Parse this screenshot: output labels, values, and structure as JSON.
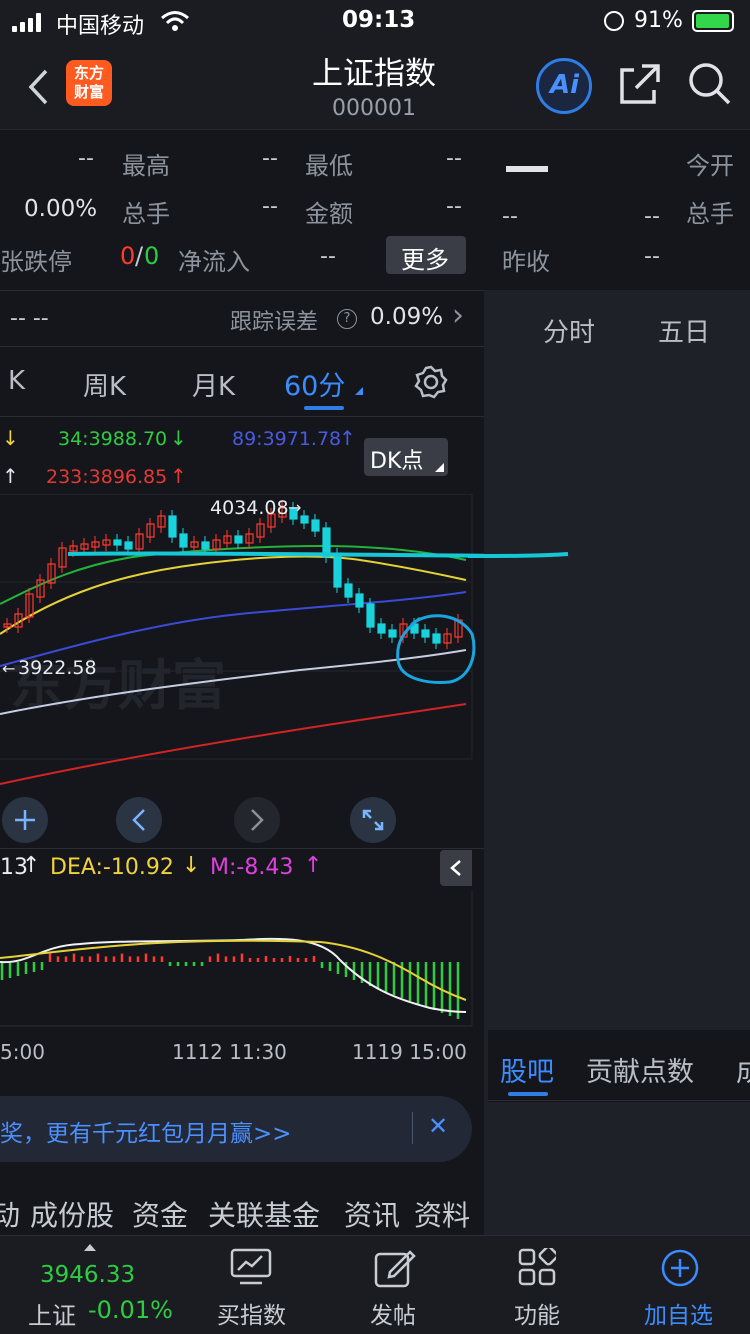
{
  "status_bar": {
    "carrier": "中国移动",
    "time": "09:13",
    "battery": "91%"
  },
  "header": {
    "title": "上证指数",
    "code": "000001",
    "logo_line1": "东方",
    "logo_line2": "财富",
    "ai_label": "Ai"
  },
  "quote": {
    "r1": {
      "v1": "--",
      "l1": "最高",
      "v2": "--",
      "l2": "最低",
      "v3": "--"
    },
    "r2": {
      "v1": "0.00%",
      "l1": "总手",
      "v2": "--",
      "l2": "金额",
      "v3": "--"
    },
    "r3": {
      "l0": "张跌停",
      "up": "0",
      "slash": "/",
      "down": "0",
      "l1": "净流入",
      "v1": "--",
      "more": "更多"
    },
    "right": {
      "big": "--",
      "open_label": "今开",
      "v_a": "--",
      "v_b": "--",
      "vol_label": "总手",
      "prev_label": "昨收",
      "prev_val": "--"
    }
  },
  "tracking": {
    "v0": "-- --",
    "label": "跟踪误差",
    "help": "?",
    "value": "0.09%",
    "chevron": "›"
  },
  "period_tabs": {
    "k": "K",
    "week": "周K",
    "month": "月K",
    "min60": "60分"
  },
  "right_tabs": {
    "intraday": "分时",
    "five_day": "五日"
  },
  "ma": {
    "a": "↓",
    "b": "34:3988.70",
    "b_arrow": "↓",
    "c": "89:3971.78",
    "c_arrow": "↑",
    "d": "↑",
    "e": "233:3896.85",
    "e_arrow": "↑",
    "dk": "DK点"
  },
  "chart_labels": {
    "high": "4034.08",
    "low": "3922.58",
    "watermark": "东方财富"
  },
  "macd": {
    "dif": "13",
    "dif_arrow": "↑",
    "dea": "DEA:-10.92",
    "dea_arrow": "↓",
    "m": "M:-8.43",
    "m_arrow": "↑"
  },
  "time_axis": {
    "t1": "5:00",
    "t2": "1112 11:30",
    "t3": "1119 15:00"
  },
  "banner": {
    "text": "奖，更有千元红包月月赢>>",
    "close": "✕"
  },
  "bottom_nav": {
    "items": [
      "动",
      "成份股",
      "资金",
      "关联基金",
      "资讯",
      "资料"
    ]
  },
  "right_bottom_tabs": {
    "guba": "股吧",
    "contrib": "贡献点数",
    "more": "成"
  },
  "tabbar": {
    "price": "3946.33",
    "name": "上证",
    "change": "-0.01%",
    "buy": "买指数",
    "post": "发帖",
    "func": "功能",
    "add": "加自选"
  },
  "colors": {
    "up": "#ff3b30",
    "down": "#2ecc40",
    "accent": "#2f7ee6",
    "cyan": "#16c7d6",
    "annotation": "#19a6e0"
  },
  "icons": [
    "signal-icon",
    "wifi-icon",
    "back-icon",
    "share-icon",
    "search-icon",
    "gear-icon",
    "plus-icon",
    "chevron-left-icon",
    "chevron-right-icon",
    "expand-icon",
    "chart-icon",
    "edit-icon",
    "grid-icon",
    "add-circle-icon"
  ]
}
